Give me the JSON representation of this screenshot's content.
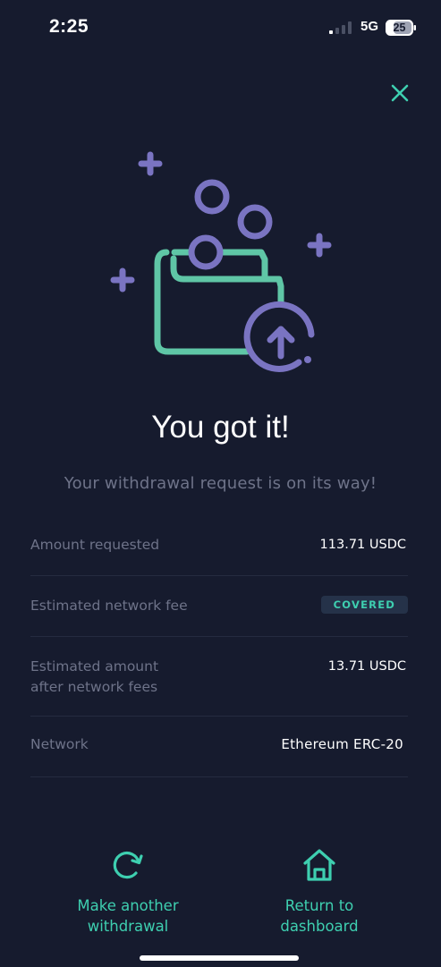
{
  "status_bar": {
    "time": "2:25",
    "network": "5G",
    "battery": "25"
  },
  "colors": {
    "background": "#161b2e",
    "accent": "#3ecfb0",
    "illustration_purple": "#7a74c2"
  },
  "icons": {
    "close": "close-icon",
    "illustration": "wallet-coins-illustration",
    "make_another": "refresh-icon",
    "return": "home-icon"
  },
  "main": {
    "title": "You got it!",
    "subtitle": "Your withdrawal request is on its way!"
  },
  "details": {
    "amount_requested": {
      "label": "Amount requested",
      "value": "113.71 USDC"
    },
    "network_fee": {
      "label": "Estimated network fee",
      "badge": "COVERED"
    },
    "after_fees": {
      "label_line1": "Estimated amount",
      "label_line2": "after network fees",
      "value": "13.71 USDC"
    },
    "network": {
      "label": "Network",
      "value": "Ethereum ERC-20"
    }
  },
  "actions": {
    "make_another": {
      "line1": "Make another",
      "line2": "withdrawal"
    },
    "return_dashboard": {
      "line1": "Return to",
      "line2": "dashboard"
    }
  }
}
